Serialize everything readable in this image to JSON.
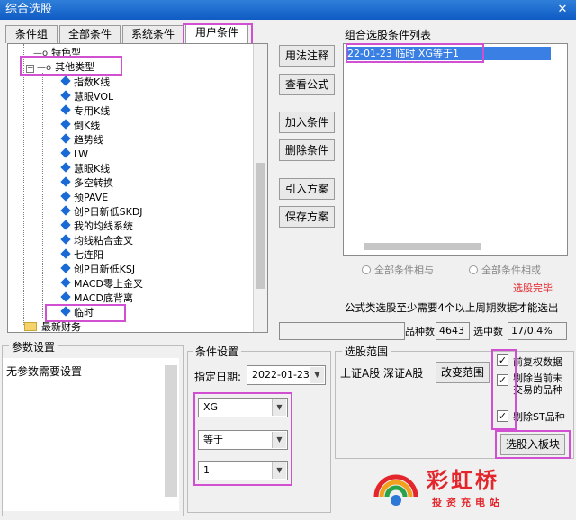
{
  "window": {
    "title": "综合选股",
    "close_icon": "close-icon"
  },
  "tabs": [
    {
      "label": "条件组"
    },
    {
      "label": "全部条件"
    },
    {
      "label": "系统条件"
    },
    {
      "label": "用户条件"
    }
  ],
  "tree": {
    "items": [
      {
        "label": "特色型"
      },
      {
        "label": "其他类型"
      },
      {
        "label": "指数K线"
      },
      {
        "label": "慧眼VOL"
      },
      {
        "label": "专用K线"
      },
      {
        "label": "倒K线"
      },
      {
        "label": "趋势线"
      },
      {
        "label": "LW"
      },
      {
        "label": "慧眼K线"
      },
      {
        "label": "多空转换"
      },
      {
        "label": "预PAVE"
      },
      {
        "label": "创P日新低SKDJ"
      },
      {
        "label": "我的均线系统"
      },
      {
        "label": "均线粘合金叉"
      },
      {
        "label": "七连阳"
      },
      {
        "label": "创P日新低KSJ"
      },
      {
        "label": "MACD零上金叉"
      },
      {
        "label": "MACD底背离"
      },
      {
        "label": "临时"
      },
      {
        "label": "最新财务"
      }
    ]
  },
  "buttons": {
    "usage_note": "用法注释",
    "view_formula": "查看公式",
    "add_condition": "加入条件",
    "delete_condition": "删除条件",
    "import_plan": "引入方案",
    "save_plan": "保存方案",
    "change_range": "改变范围",
    "select_to_sector": "选股入板块"
  },
  "condition_list": {
    "title": "组合选股条件列表",
    "rows": [
      "22-01-23 临时 XG等于1"
    ],
    "radio_and": "全部条件相与",
    "radio_or": "全部条件相或",
    "status": "选股完毕",
    "note": "公式类选股至少需要4个以上周期数据才能选出",
    "stock_count_label": "品种数",
    "stock_count": "4643",
    "selected_label": "选中数",
    "selected_value": "17/0.4%"
  },
  "params": {
    "title": "参数设置",
    "text": "无参数需要设置"
  },
  "conditions": {
    "title": "条件设置",
    "date_label": "指定日期:",
    "date_value": "2022-01-23",
    "var": "XG",
    "op": "等于",
    "value": "1"
  },
  "range": {
    "title": "选股范围",
    "markets": "上证A股 深证A股",
    "check_rights": "前复权数据",
    "check_untradable": "剔除当前未交易的品种",
    "check_st": "剔除ST品种"
  },
  "watermark": {
    "name": "彩虹桥",
    "tagline": "投资充电站"
  },
  "colors": {
    "highlight": "#d14fd1",
    "title_bar": "#1668d0",
    "selection": "#3a7fe3",
    "status_red": "#e3262c"
  }
}
